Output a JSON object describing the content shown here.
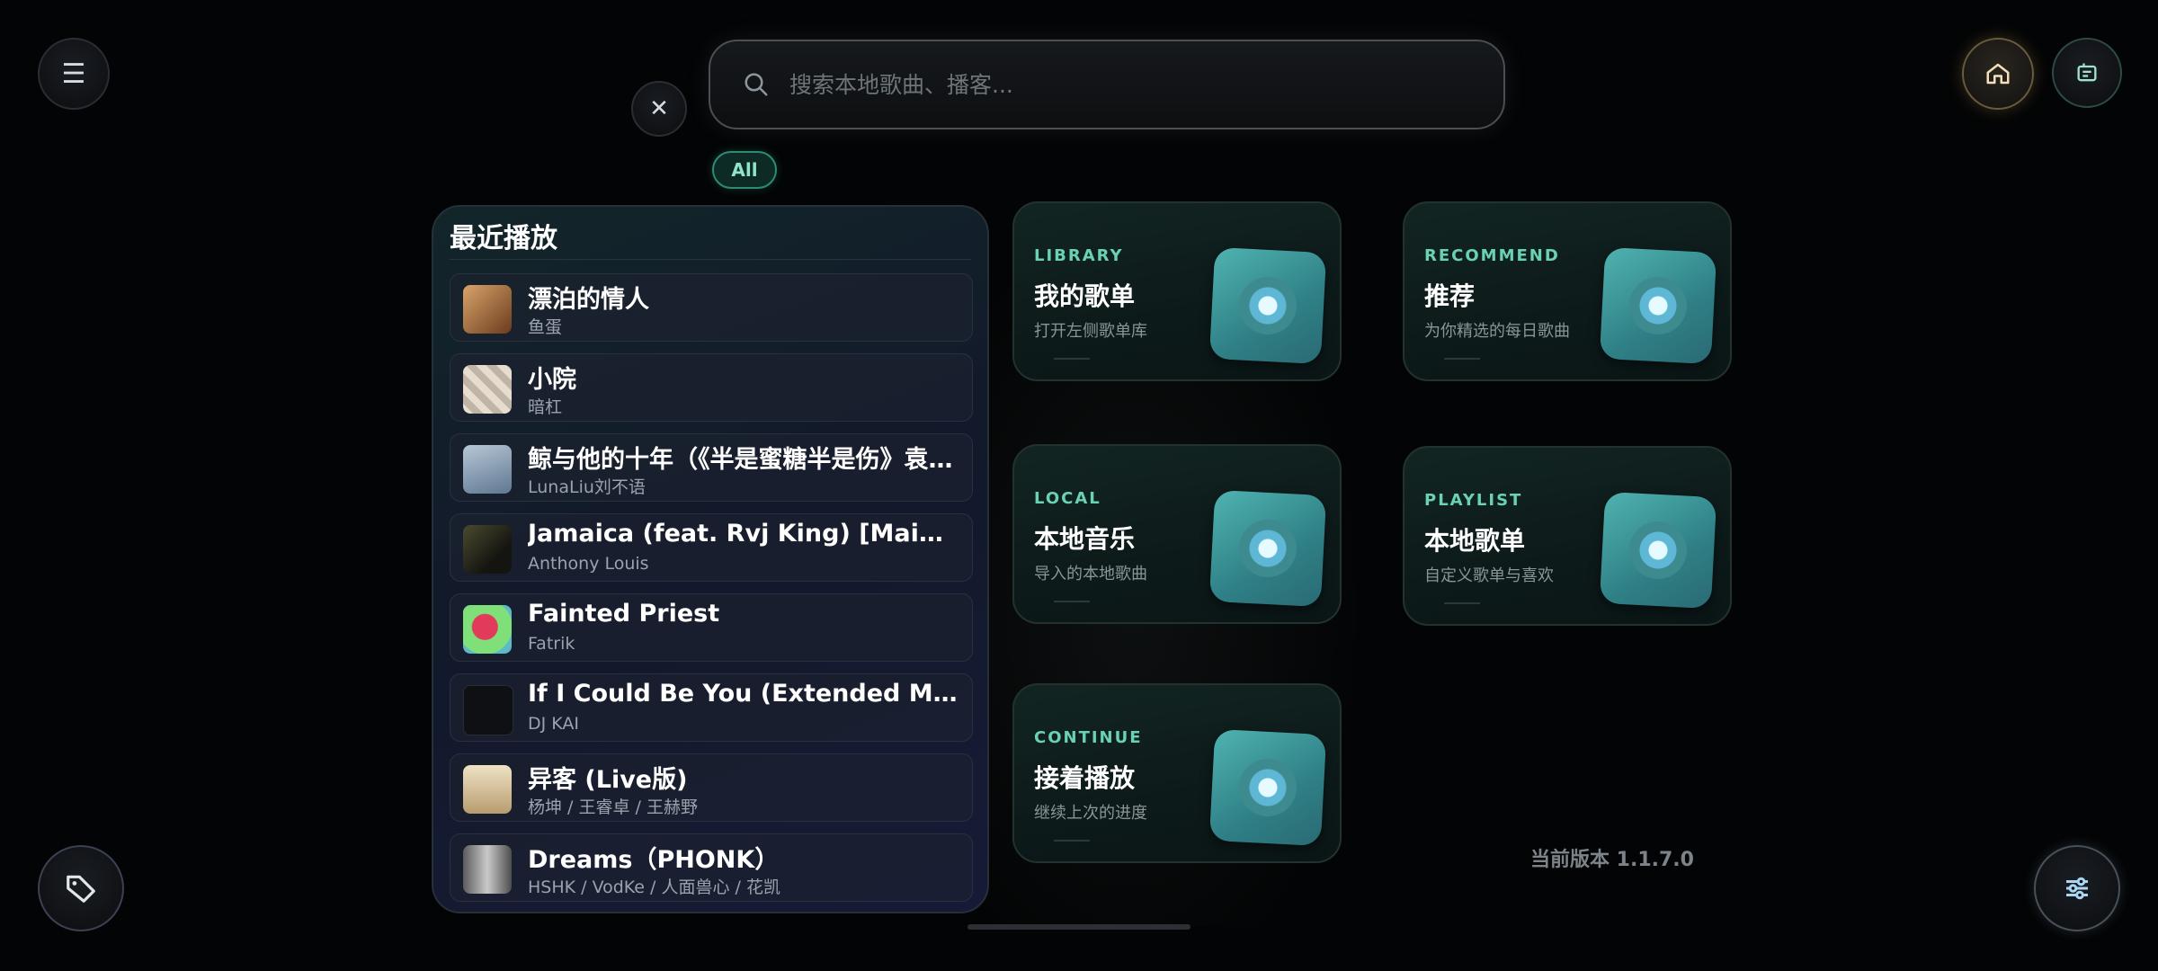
{
  "top_buttons": {
    "menu_glyph": "☰",
    "close_glyph": "✕"
  },
  "search": {
    "placeholder": "搜索本地歌曲、播客..."
  },
  "filter_chip": {
    "label": "All"
  },
  "recent": {
    "title": "最近播放",
    "songs": [
      {
        "title": "漂泊的情人",
        "artist": "鱼蛋",
        "cover": "#b27a44"
      },
      {
        "title": "小院",
        "artist": "暗杠",
        "cover": "#d8cfbf"
      },
      {
        "title": "鲸与他的十年（《半是蜜糖半是伤》袁…",
        "artist": "LunaLiu刘不语",
        "cover": "#8aa1b7"
      },
      {
        "title": "Jamaica (feat. Rvj King) [Main Ver…",
        "artist": "Anthony Louis",
        "cover": "#3a3a2a"
      },
      {
        "title": "Fainted Priest",
        "artist": "Fatrik",
        "cover": "#6ad36b"
      },
      {
        "title": "If I Could Be You (Extended Mix)",
        "artist": "DJ KAI",
        "cover": "#111114"
      },
      {
        "title": "异客 (Live版)",
        "artist": "杨坤 / 王睿卓 / 王赫野",
        "cover": "#d9c7a4"
      },
      {
        "title": "Dreams（PHONK）",
        "artist": "HSHK / VodKe / 人面兽心 / 花凯",
        "cover": "#8d8d8d"
      }
    ]
  },
  "cards": [
    {
      "eyebrow": "LIBRARY",
      "title": "我的歌单",
      "subtitle": "打开左侧歌单库"
    },
    {
      "eyebrow": "RECOMMEND",
      "title": "推荐",
      "subtitle": "为你精选的每日歌曲"
    },
    {
      "eyebrow": "LOCAL",
      "title": "本地音乐",
      "subtitle": "导入的本地歌曲"
    },
    {
      "eyebrow": "PLAYLIST",
      "title": "本地歌单",
      "subtitle": "自定义歌单与喜欢"
    },
    {
      "eyebrow": "CONTINUE",
      "title": "接着播放",
      "subtitle": "继续上次的进度"
    }
  ],
  "version_text": "当前版本 1.1.7.0",
  "colors": {
    "accent": "#69d2b3",
    "background": "#030405",
    "home_glow": "#dcb46e"
  },
  "icons": {
    "menu": "menu-icon",
    "close": "close-icon",
    "search": "search-icon",
    "home": "home-icon",
    "news": "news-icon",
    "tag": "tag-icon",
    "tune": "sliders-icon"
  }
}
